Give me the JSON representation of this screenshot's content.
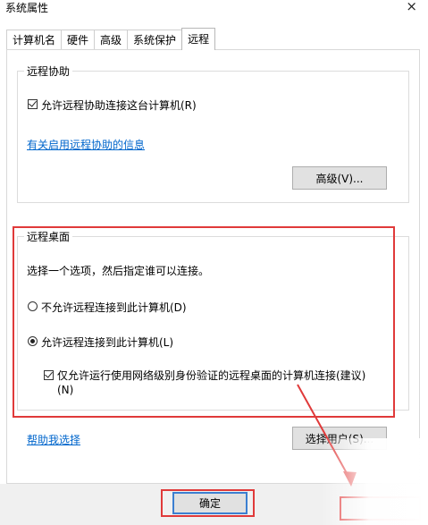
{
  "window": {
    "title": "系统属性",
    "close_glyph": "×"
  },
  "tabs": [
    {
      "label": "计算机名"
    },
    {
      "label": "硬件"
    },
    {
      "label": "高级"
    },
    {
      "label": "系统保护"
    },
    {
      "label": "远程",
      "active": true
    }
  ],
  "remote_assistance": {
    "group_title": "远程协助",
    "allow_checkbox_label": "允许远程协助连接这台计算机(R)",
    "allow_checked": true,
    "info_link": "有关启用远程协助的信息",
    "advanced_button": "高级(V)..."
  },
  "remote_desktop": {
    "group_title": "远程桌面",
    "instruction": "选择一个选项，然后指定谁可以连接。",
    "option_disallow": "不允许远程连接到此计算机(D)",
    "option_allow": "允许远程连接到此计算机(L)",
    "selected_option": "allow",
    "nla_checkbox_line1": "仅允许运行使用网络级别身份验证的远程桌面的计算机连接(建议)",
    "nla_checkbox_line2": "(N)",
    "nla_checked": true,
    "help_link": "帮助我选择",
    "select_users_button": "选择用户(S)..."
  },
  "footer": {
    "ok_button": "确定"
  },
  "colors": {
    "highlight_red": "#e03a3a",
    "link_blue": "#0066cc",
    "default_button_border": "#3c7fd1"
  }
}
